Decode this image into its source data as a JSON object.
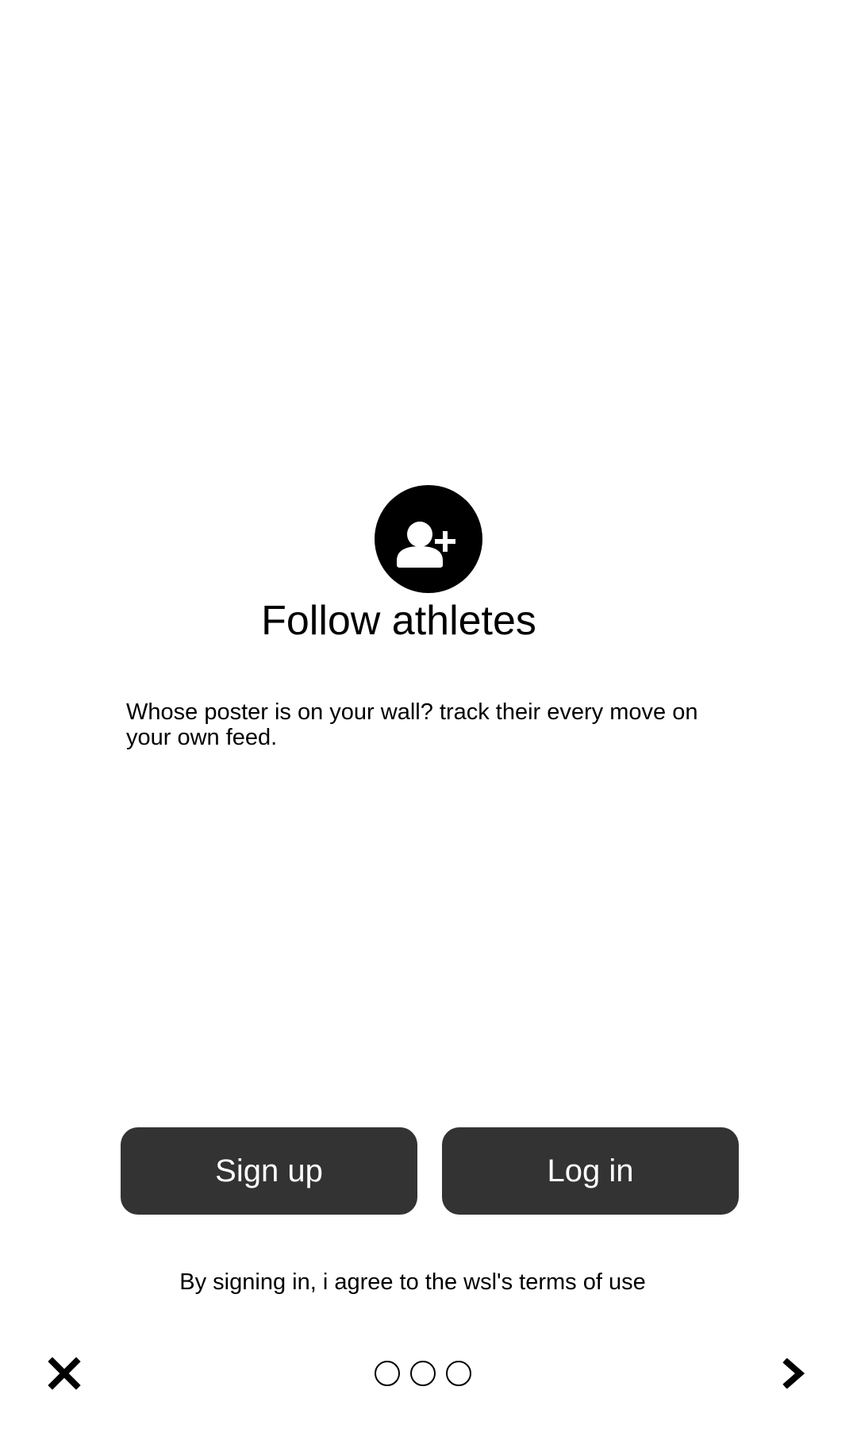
{
  "onboarding": {
    "title": "Follow athletes",
    "description": "Whose poster is on your wall? track their every move on your own feed.",
    "icon": "person-add-icon"
  },
  "buttons": {
    "sign_up": "Sign up",
    "log_in": "Log in"
  },
  "terms": "By signing in, i agree to the wsl's terms of use",
  "navigation": {
    "close_icon": "close-icon",
    "next_icon": "chevron-right-icon",
    "page_count": 3
  },
  "colors": {
    "button_background": "#333333",
    "button_text": "#ffffff",
    "icon_circle": "#000000",
    "background": "#ffffff"
  }
}
